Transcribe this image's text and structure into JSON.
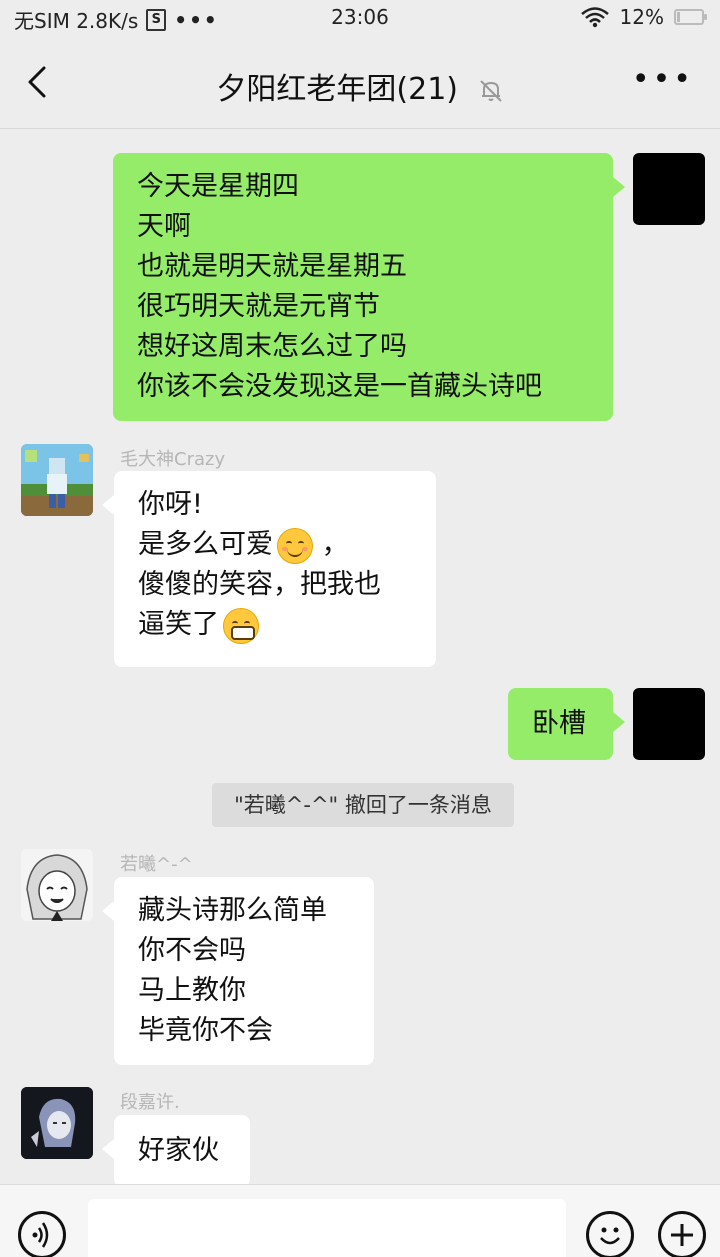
{
  "status_bar": {
    "carrier": "无SIM 2.8K/s",
    "sim_icon_text": "S",
    "more_dots": "•••",
    "time": "23:06",
    "battery_percent": "12%",
    "battery_level": 0.12
  },
  "header": {
    "title": "夕阳红老年团(21)",
    "more_label": "•••"
  },
  "messages": [
    {
      "side": "right",
      "lines": [
        "今天是星期四",
        "天啊",
        "也就是明天就是星期五",
        "很巧明天就是元宵节",
        "想好这周末怎么过了吗",
        "你该不会没发现这是一首藏头诗吧"
      ]
    },
    {
      "side": "left",
      "sender": "毛大神Crazy",
      "lines": [
        "你呀!",
        "是多么可爱",
        "傻傻的笑容，把我也",
        "逼笑了"
      ]
    },
    {
      "side": "right",
      "lines": [
        "卧槽"
      ]
    },
    {
      "side": "left",
      "sender": "若曦^-^",
      "lines": [
        "藏头诗那么简单",
        "你不会吗",
        "马上教你",
        "毕竟你不会"
      ]
    },
    {
      "side": "left",
      "sender": "段嘉许.",
      "lines": [
        "好家伙"
      ]
    }
  ],
  "system_message": "\"若曦^-^\" 撤回了一条消息",
  "emoji_after_line": " ，",
  "colors": {
    "background": "#ededed",
    "self_bubble": "#95ec69",
    "other_bubble": "#ffffff"
  },
  "input": {
    "value": "",
    "placeholder": ""
  }
}
